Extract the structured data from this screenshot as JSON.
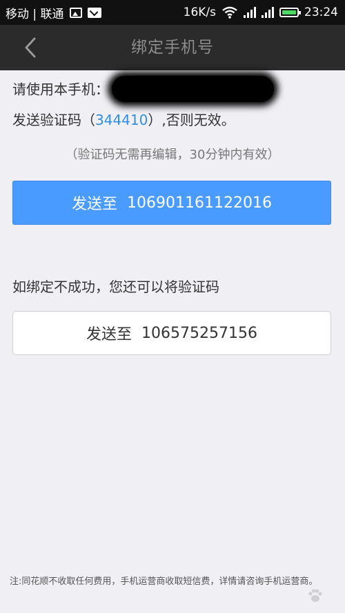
{
  "status_bar": {
    "carrier": "移动 | 联通",
    "speed": "16K/s",
    "time": "23:24",
    "icons": [
      "image-icon",
      "mail-icon",
      "wifi-icon",
      "signal-icon",
      "signal-icon",
      "battery-icon"
    ]
  },
  "header": {
    "title": "绑定手机号",
    "back_icon": "chevron-left-icon"
  },
  "instructions": {
    "line1_prefix": "请使用本手机：",
    "line2_prefix": "发送验证码（",
    "code": "344410",
    "line2_suffix": "）,否则无效。",
    "hint": "（验证码无需再编辑，30分钟内有效）"
  },
  "primary_button": {
    "label": "发送至",
    "number": "106901161122016"
  },
  "fallback": {
    "text": "如绑定不成功，您还可以将验证码"
  },
  "secondary_button": {
    "label": "发送至",
    "number": "106575257156"
  },
  "footer": {
    "note": "注:同花顺不收取任何费用，手机运营商收取短信费，详情请咨询手机运营商。"
  },
  "colors": {
    "accent": "#4a9bff",
    "code": "#2f8ee6",
    "header_bg": "#2b2b2b",
    "page_bg": "#efeff4"
  }
}
